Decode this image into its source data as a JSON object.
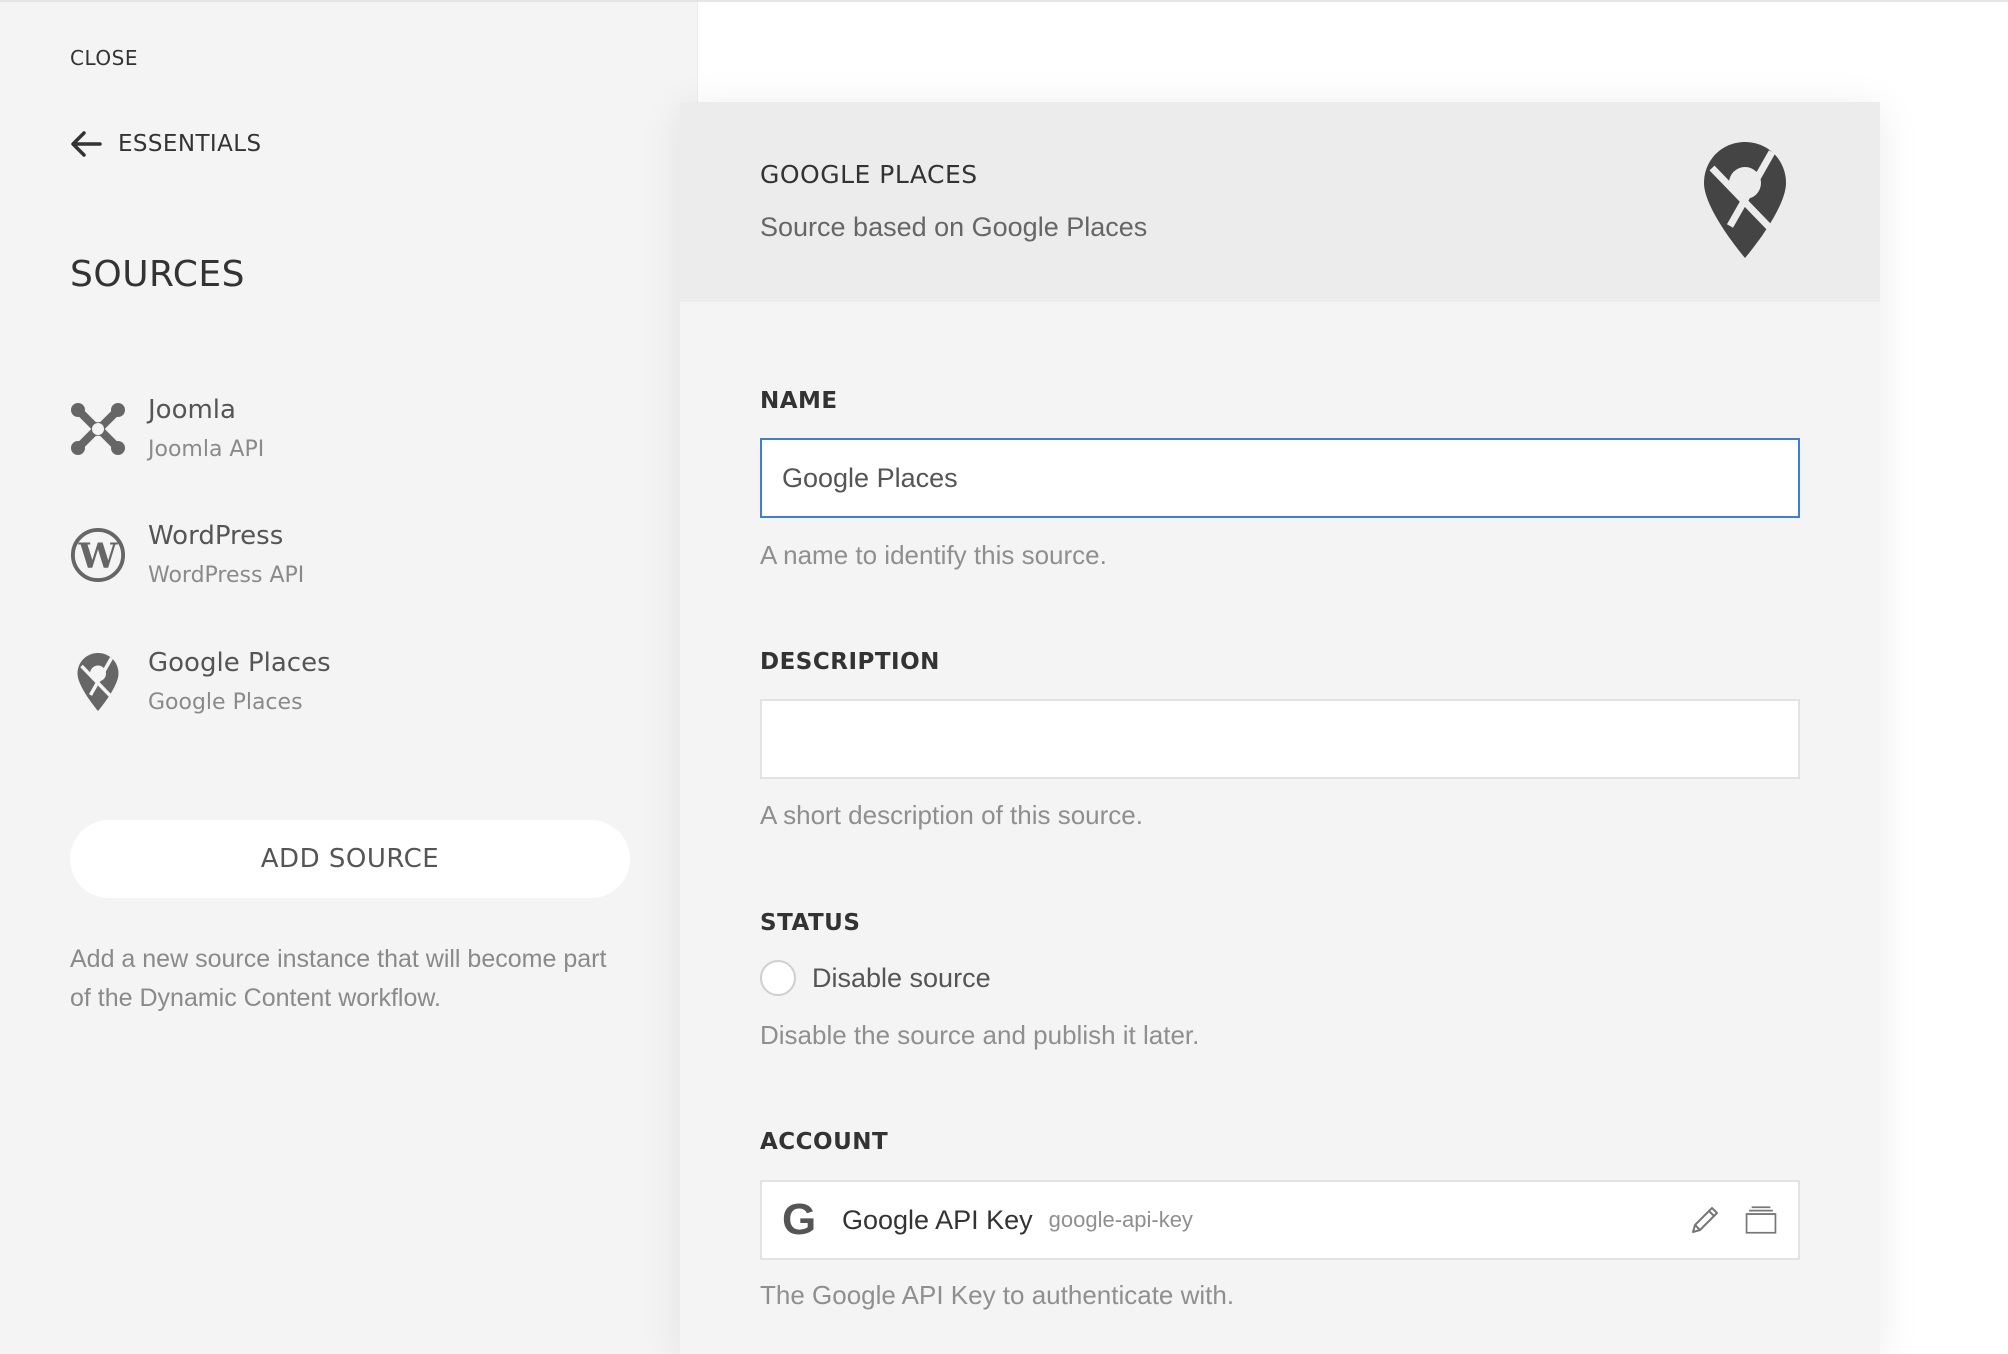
{
  "sidebar": {
    "close_label": "CLOSE",
    "back_label": "ESSENTIALS",
    "title": "SOURCES",
    "items": [
      {
        "label": "Joomla",
        "sublabel": "Joomla API",
        "icon": "joomla-icon"
      },
      {
        "label": "WordPress",
        "sublabel": "WordPress API",
        "icon": "wordpress-icon"
      },
      {
        "label": "Google Places",
        "sublabel": "Google Places",
        "icon": "map-pin-icon"
      }
    ],
    "add_button": "ADD SOURCE",
    "add_help": "Add a new source instance that will become part of the Dynamic Content workflow."
  },
  "panel": {
    "title": "GOOGLE PLACES",
    "subtitle": "Source based on Google Places",
    "icon": "map-pin-icon",
    "name": {
      "label": "NAME",
      "value": "Google Places",
      "help": "A name to identify this source."
    },
    "description": {
      "label": "DESCRIPTION",
      "value": "",
      "help": "A short description of this source."
    },
    "status": {
      "label": "STATUS",
      "option": "Disable source",
      "help": "Disable the source and publish it later."
    },
    "account": {
      "label": "ACCOUNT",
      "glyph": "G",
      "name": "Google API Key",
      "slug": "google-api-key",
      "help": "The Google API Key to authenticate with."
    }
  },
  "colors": {
    "focus_border": "#3d7fd4",
    "sidebar_bg": "#f4f4f4",
    "panel_head_bg": "#ececec"
  }
}
